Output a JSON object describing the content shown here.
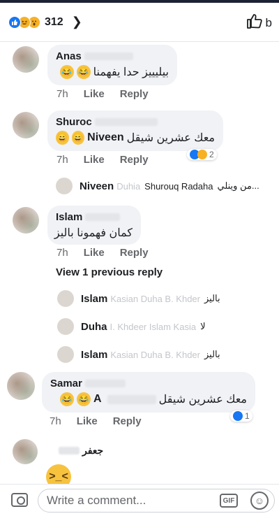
{
  "header": {
    "count": "312",
    "chevron": "❯",
    "clipped_text": "b"
  },
  "comments": [
    {
      "name": "Anas",
      "text": "بيليييز حدا يفهمنا",
      "emoji": [
        "😂",
        "😂"
      ],
      "time": "7h",
      "like": "Like",
      "reply": "Reply"
    },
    {
      "name": "Shuroc",
      "mention": "Niveen",
      "text": "معك عشرين شيقل",
      "emoji": [
        "😄",
        "😄"
      ],
      "time": "7h",
      "like": "Like",
      "reply": "Reply",
      "reaction_count": "2"
    },
    {
      "name": "Islam",
      "text": "كمان فهمونا باليز",
      "time": "7h",
      "like": "Like",
      "reply": "Reply"
    },
    {
      "name": "Samar",
      "mention": "A",
      "text": "معك عشرين شيقل",
      "emoji": [
        "😂",
        "😂"
      ],
      "time": "7h",
      "like": "Like",
      "reply": "Reply",
      "reaction_count": "1"
    }
  ],
  "replies": [
    {
      "name": "Niveen",
      "blur": "Duhia",
      "rest": "Shurouq Radaha",
      "preview": "من وينلي..."
    },
    {
      "name": "Islam",
      "blur": "Kasian Duha B. Khder",
      "preview": "باليز"
    },
    {
      "name": "Duha",
      "blur": "I. Khdeer Islam Kasia",
      "preview": "لا"
    },
    {
      "name": "Islam",
      "blur": "Kasian Duha B. Khder",
      "preview": "باليز"
    }
  ],
  "view_previous": "View 1 previous reply",
  "last_comment": {
    "name": "جعفر"
  },
  "composer": {
    "placeholder": "Write a comment...",
    "gif": "GIF"
  }
}
